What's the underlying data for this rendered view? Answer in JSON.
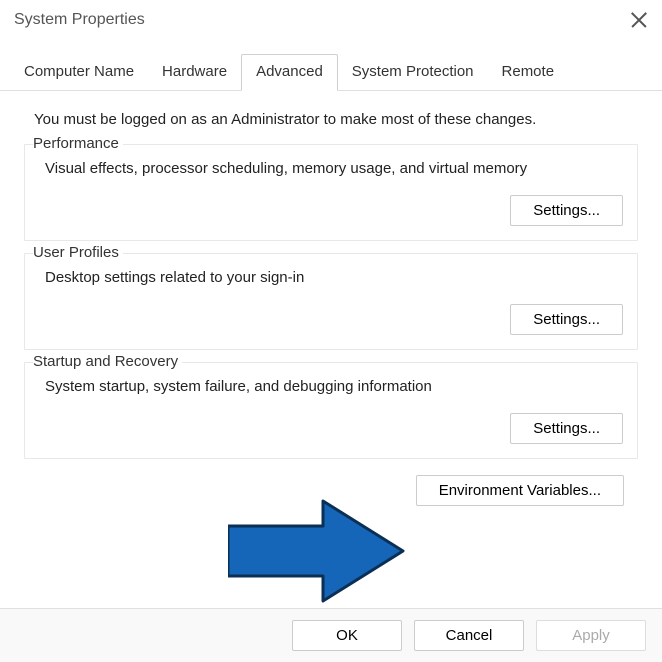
{
  "window": {
    "title": "System Properties"
  },
  "tabs": [
    {
      "label": "Computer Name",
      "active": false
    },
    {
      "label": "Hardware",
      "active": false
    },
    {
      "label": "Advanced",
      "active": true
    },
    {
      "label": "System Protection",
      "active": false
    },
    {
      "label": "Remote",
      "active": false
    }
  ],
  "admin_notice": "You must be logged on as an Administrator to make most of these changes.",
  "sections": {
    "performance": {
      "title": "Performance",
      "desc": "Visual effects, processor scheduling, memory usage, and virtual memory",
      "button": "Settings..."
    },
    "user_profiles": {
      "title": "User Profiles",
      "desc": "Desktop settings related to your sign-in",
      "button": "Settings..."
    },
    "startup": {
      "title": "Startup and Recovery",
      "desc": "System startup, system failure, and debugging information",
      "button": "Settings..."
    }
  },
  "env_button": "Environment Variables...",
  "footer": {
    "ok": "OK",
    "cancel": "Cancel",
    "apply": "Apply"
  }
}
